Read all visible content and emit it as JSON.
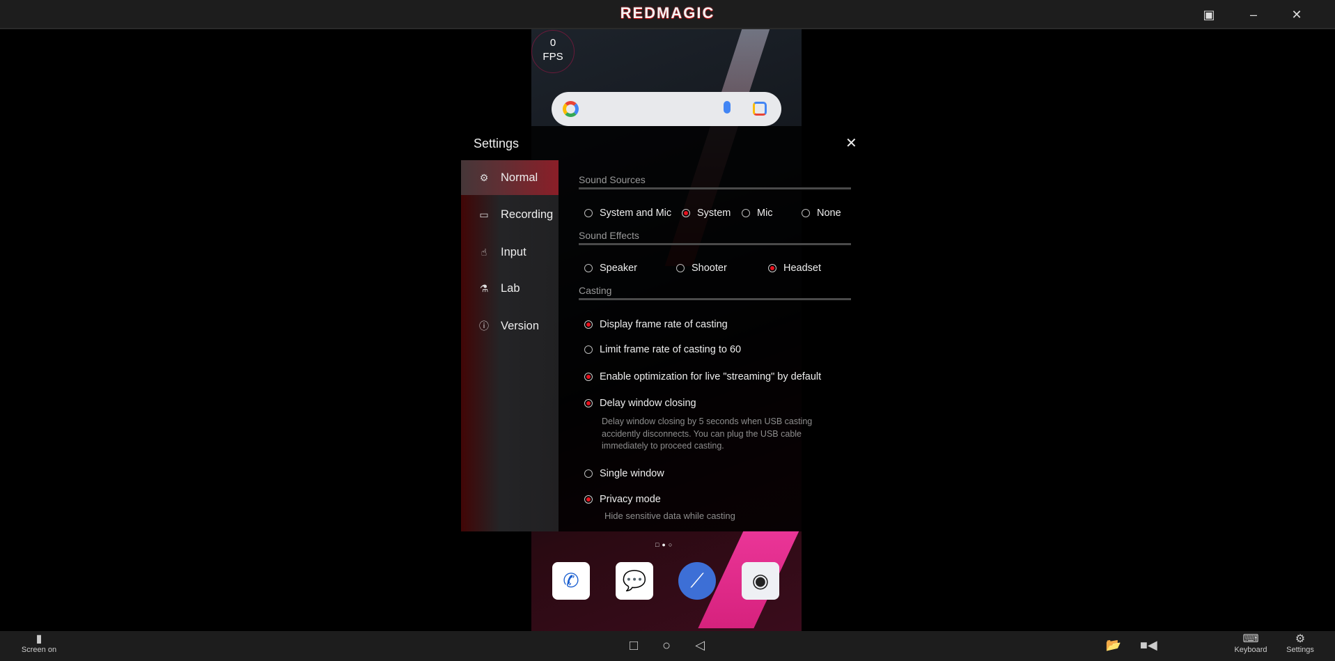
{
  "window": {
    "logo": "REDMAGIC",
    "icons": [
      "pin-icon",
      "minimize-icon",
      "close-icon"
    ]
  },
  "phone": {
    "fps_value": "0",
    "fps_label": "FPS",
    "dock_apps": [
      "phone-app",
      "messages-app",
      "browser-app",
      "camera-app"
    ],
    "page_indicator": {
      "pages": 3,
      "current": 2
    }
  },
  "settings": {
    "title": "Settings",
    "nav": [
      {
        "label": "Normal",
        "icon": "gear-icon",
        "active": true
      },
      {
        "label": "Recording",
        "icon": "video-camera-icon"
      },
      {
        "label": "Input",
        "icon": "hand-pointer-icon"
      },
      {
        "label": "Lab",
        "icon": "flask-icon"
      },
      {
        "label": "Version",
        "icon": "info-icon"
      }
    ],
    "sound_sources": {
      "title": "Sound Sources",
      "options": [
        "System and Mic",
        "System",
        "Mic",
        "None"
      ],
      "selected": "System"
    },
    "sound_effects": {
      "title": "Sound Effects",
      "options": [
        "Speaker",
        "Shooter",
        "Headset"
      ],
      "selected": "Headset"
    },
    "casting": {
      "title": "Casting",
      "items": [
        {
          "label": "Display frame rate of casting",
          "checked": true
        },
        {
          "label": "Limit frame rate of casting to 60",
          "checked": false
        },
        {
          "label": "Enable optimization for live \"streaming\" by default",
          "checked": true
        },
        {
          "label": "Delay window closing",
          "checked": true,
          "desc": [
            "Delay window closing by 5 seconds when USB casting",
            "accidently disconnects. You can plug the USB cable",
            "immediately to proceed casting."
          ]
        },
        {
          "label": "Single window",
          "checked": false
        },
        {
          "label": "Privacy mode",
          "checked": true,
          "desc": [
            "Hide sensitive data while casting"
          ]
        }
      ]
    }
  },
  "bottombar": {
    "screen_on": "Screen on",
    "keyboard": "Keyboard",
    "settings": "Settings"
  },
  "colors": {
    "accent": "#e8121e",
    "bar": "#1d1d1d"
  }
}
